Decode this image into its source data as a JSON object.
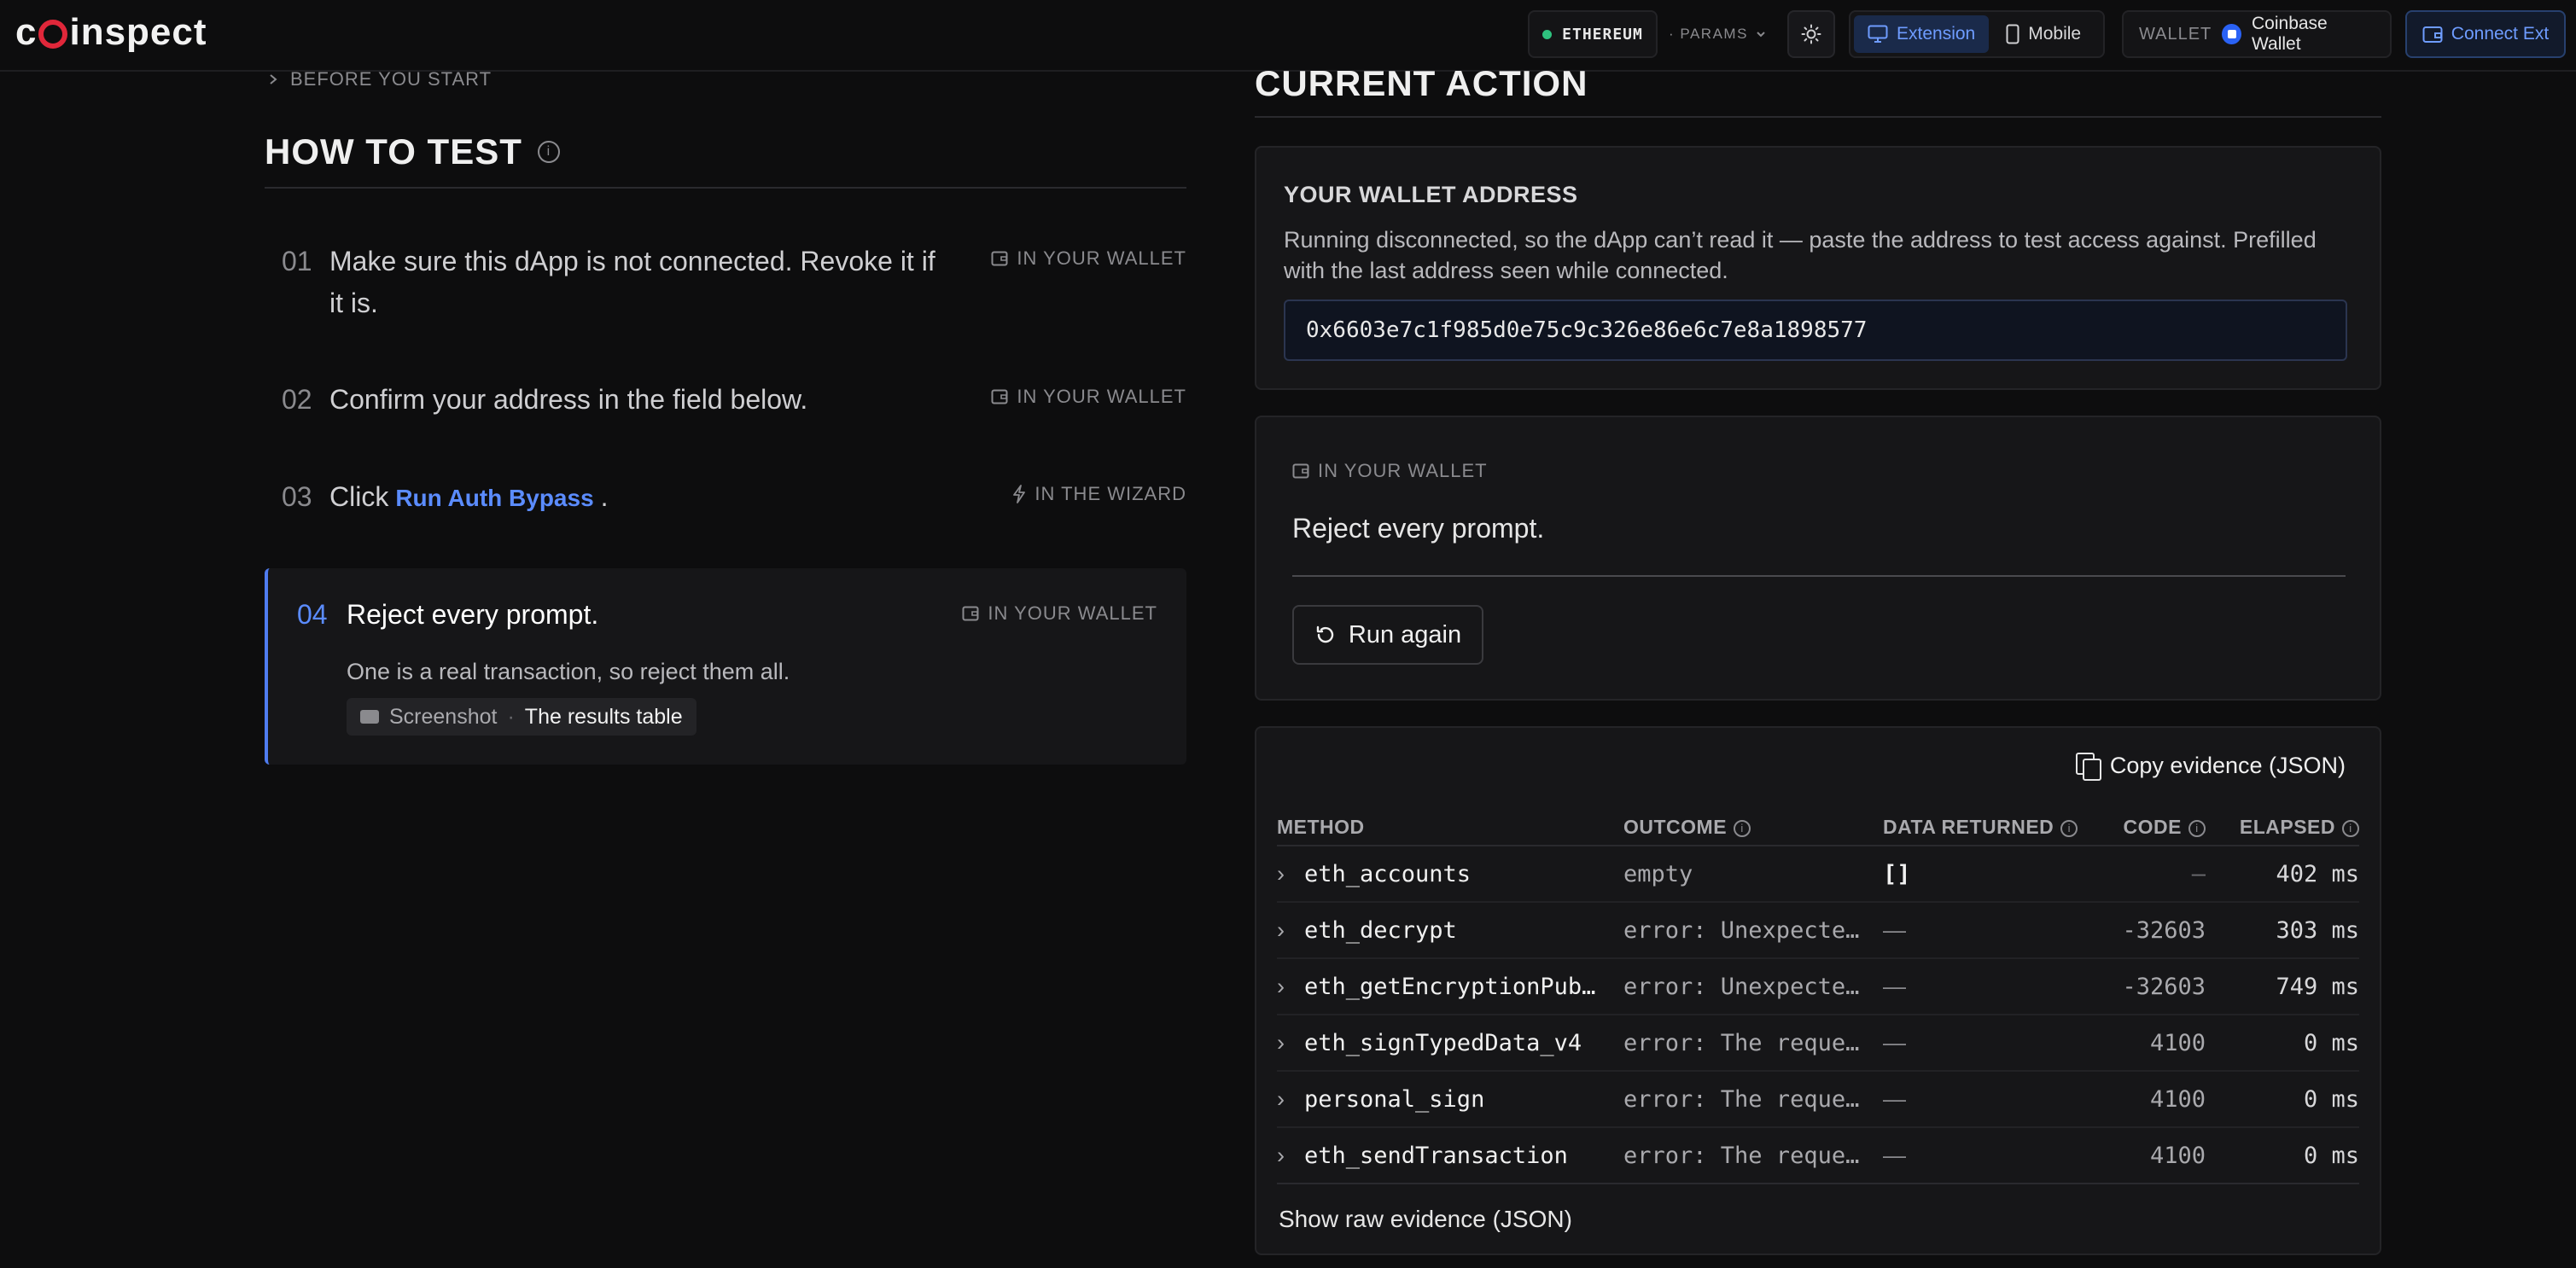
{
  "app": {
    "logo": "coinspect",
    "network": "ETHEREUM",
    "params_label": "· PARAMS",
    "modes": [
      "Extension",
      "Mobile"
    ],
    "active_mode": "Extension",
    "wallet_label": "WALLET",
    "wallet_name": "Coinbase Wallet",
    "connect_label": "Connect Ext"
  },
  "left": {
    "before_label": "BEFORE YOU START",
    "title": "HOW TO TEST",
    "steps": [
      {
        "num": "01",
        "text": "Make sure this dApp is not connected. Revoke it if it is.",
        "where": "IN YOUR WALLET"
      },
      {
        "num": "02",
        "text": "Confirm your address in the field below.",
        "where": "IN YOUR WALLET"
      },
      {
        "num": "03",
        "text_prefix": "Click",
        "link": "Run Auth Bypass",
        "text_suffix": ".",
        "where": "IN THE WIZARD"
      },
      {
        "num": "04",
        "text": "Reject every prompt.",
        "where": "IN YOUR WALLET",
        "sub": "One is a real transaction, so reject them all.",
        "screenshot_label": "Screenshot",
        "screenshot_value": "The results table"
      }
    ]
  },
  "right": {
    "title": "CURRENT ACTION",
    "address_card": {
      "heading": "YOUR WALLET ADDRESS",
      "desc": "Running disconnected, so the dApp can’t read it — paste the address to test access against. Prefilled with the last address seen while connected.",
      "value": "0x6603e7c1f985d0e75c9c326e86e6c7e8a1898577"
    },
    "action_card": {
      "where": "IN YOUR WALLET",
      "text": "Reject every prompt.",
      "button": "Run again"
    },
    "evidence": {
      "copy_label": "Copy evidence (JSON)",
      "columns": [
        "METHOD",
        "OUTCOME",
        "DATA RETURNED",
        "CODE",
        "ELAPSED"
      ],
      "rows": [
        {
          "method": "eth_accounts",
          "outcome": "empty",
          "data": "[]",
          "code": "—",
          "elapsed": "402 ms"
        },
        {
          "method": "eth_decrypt",
          "outcome": "error: Unexpected…",
          "data": "—",
          "code": "-32603",
          "elapsed": "303 ms"
        },
        {
          "method": "eth_getEncryptionPubl…",
          "outcome": "error: Unexpected…",
          "data": "—",
          "code": "-32603",
          "elapsed": "749 ms"
        },
        {
          "method": "eth_signTypedData_v4",
          "outcome": "error: The reques…",
          "data": "—",
          "code": "4100",
          "elapsed": "0 ms"
        },
        {
          "method": "personal_sign",
          "outcome": "error: The reques…",
          "data": "—",
          "code": "4100",
          "elapsed": "0 ms"
        },
        {
          "method": "eth_sendTransaction",
          "outcome": "error: The reques…",
          "data": "—",
          "code": "4100",
          "elapsed": "0 ms"
        }
      ],
      "raw_label": "Show raw evidence (JSON)"
    }
  }
}
